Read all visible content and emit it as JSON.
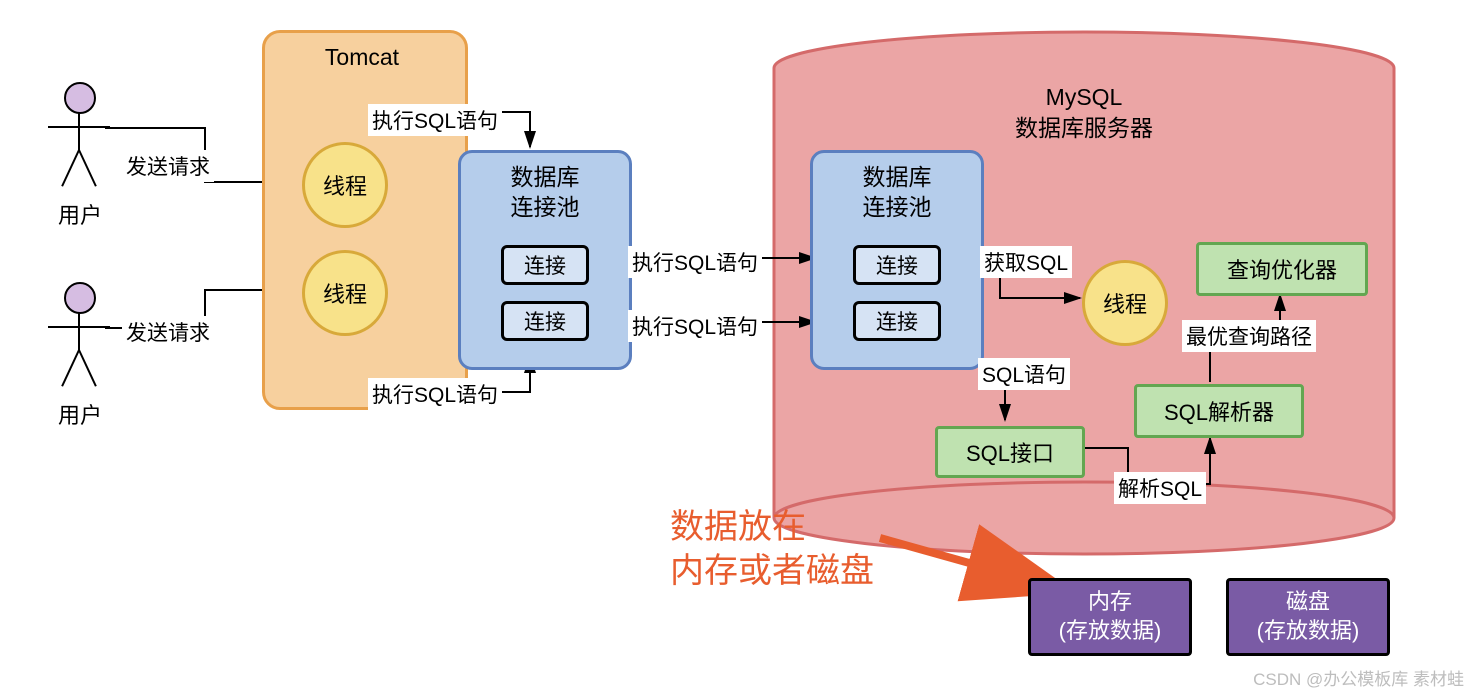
{
  "users": {
    "label": "用户",
    "send_request": "发送请求"
  },
  "tomcat": {
    "title": "Tomcat",
    "thread": "线程",
    "exec_sql": "执行SQL语句",
    "pool": {
      "title_line1": "数据库",
      "title_line2": "连接池",
      "conn": "连接"
    }
  },
  "between": {
    "exec_sql": "执行SQL语句"
  },
  "mysql": {
    "title_line1": "MySQL",
    "title_line2": "数据库服务器",
    "pool": {
      "title_line1": "数据库",
      "title_line2": "连接池",
      "conn": "连接"
    },
    "get_sql": "获取SQL",
    "thread": "线程",
    "sql_statement": "SQL语句",
    "sql_interface": "SQL接口",
    "parse_sql": "解析SQL",
    "sql_parser": "SQL解析器",
    "best_path": "最优查询路径",
    "optimizer": "查询优化器"
  },
  "annotation": {
    "line1": "数据放在",
    "line2": "内存或者磁盘"
  },
  "storage": {
    "memory_line1": "内存",
    "memory_line2": "(存放数据)",
    "disk_line1": "磁盘",
    "disk_line2": "(存放数据)"
  },
  "watermark": "CSDN @办公模板库 素材蛙"
}
